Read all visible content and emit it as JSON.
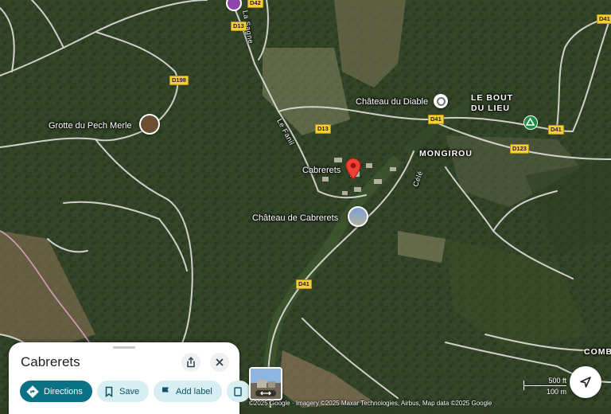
{
  "places": {
    "grotte": "Grotte du Pech Merle",
    "chateau_diable": "Château du Diable",
    "cabrerets": "Cabrerets",
    "chateau_cabrerets": "Château de Cabrerets",
    "bout_line1": "LE BOUT",
    "bout_line2": "DU LIEU",
    "mongirou": "MONGIROU",
    "combe": "COMB"
  },
  "roads": {
    "d198": "D198",
    "d13_top": "D13",
    "d13": "D13",
    "d42": "D42",
    "d41_a": "D41",
    "d41_b": "D41",
    "d41_c": "D41",
    "d41_d": "D41",
    "d123": "D123",
    "la_sagne": "La Sagne",
    "le_fanil": "Le Fanil",
    "river": "Célé"
  },
  "sheet": {
    "title": "Cabrerets",
    "directions_label": "Directions",
    "save_label": "Save",
    "add_label_label": "Add label"
  },
  "scale": {
    "feet": "500 ft",
    "meters": "100 m"
  },
  "attribution": "©2025 Google · Imagery ©2025 Maxar Technologies, Airbus, Map data ©2025 Google",
  "colors": {
    "accent": "#0b7285",
    "pin": "#ea4335",
    "road_shield": "#f5cc3a"
  },
  "icons": [
    "share-icon",
    "close-icon",
    "directions-icon",
    "bookmark-icon",
    "flag-icon",
    "my-location-icon",
    "street-view-icon"
  ]
}
